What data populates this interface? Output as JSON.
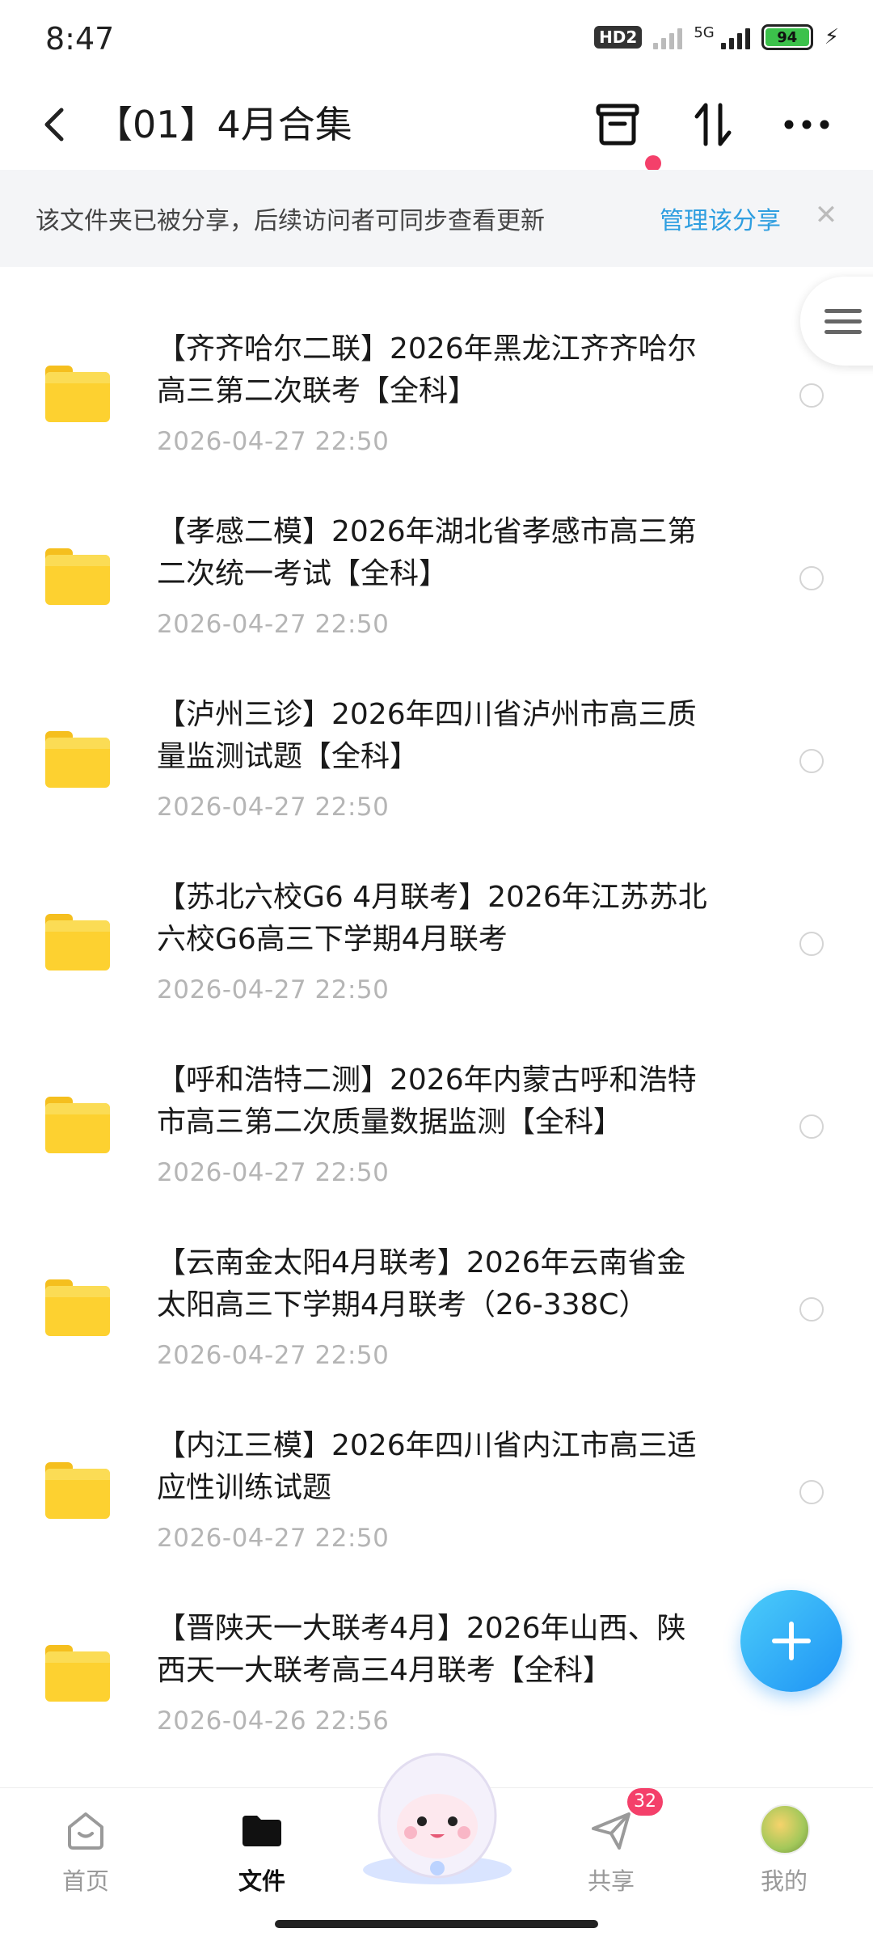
{
  "status_bar": {
    "time": "8:47",
    "hd": "HD2",
    "network": "5G",
    "battery": "94"
  },
  "header": {
    "title": "【01】4月合集",
    "icons": [
      "back-arrow-icon",
      "archive-box-icon",
      "sort-icon",
      "more-icon"
    ]
  },
  "notice": {
    "text": "该文件夹已被分享，后续访问者可同步查看更新",
    "action": "管理该分享"
  },
  "files": [
    {
      "title_line1": "【齐齐哈尔二联】2026年黑龙江齐齐哈尔",
      "title_line2": "高三第二次联考【全科】",
      "date": "2026-04-27  22:50"
    },
    {
      "title_line1": "【孝感二模】2026年湖北省孝感市高三第",
      "title_line2": "二次统一考试【全科】",
      "date": "2026-04-27  22:50"
    },
    {
      "title_line1": "【泸州三诊】2026年四川省泸州市高三质",
      "title_line2": "量监测试题【全科】",
      "date": "2026-04-27  22:50"
    },
    {
      "title_line1": "【苏北六校G6 4月联考】2026年江苏苏北",
      "title_line2": "六校G6高三下学期4月联考",
      "date": "2026-04-27  22:50"
    },
    {
      "title_line1": "【呼和浩特二测】2026年内蒙古呼和浩特",
      "title_line2": "市高三第二次质量数据监测【全科】",
      "date": "2026-04-27  22:50"
    },
    {
      "title_line1": "【云南金太阳4月联考】2026年云南省金",
      "title_line2": "太阳高三下学期4月联考（26-338C）",
      "date": "2026-04-27  22:50"
    },
    {
      "title_line1": "【内江三模】2026年四川省内江市高三适",
      "title_line2": "应性训练试题",
      "date": "2026-04-27  22:50"
    },
    {
      "title_line1": "【晋陕天一大联考4月】2026年山西、陕",
      "title_line2": "西天一大联考高三4月联考【全科】",
      "date": "2026-04-26  22:56"
    }
  ],
  "bottom_nav": {
    "home": "首页",
    "files": "文件",
    "share": "共享",
    "share_badge": "32",
    "mine": "我的"
  },
  "colors": {
    "accent": "#2e9ee0",
    "folder": "#fdd130",
    "badge": "#f4406a",
    "fab": "#1e93f5"
  }
}
